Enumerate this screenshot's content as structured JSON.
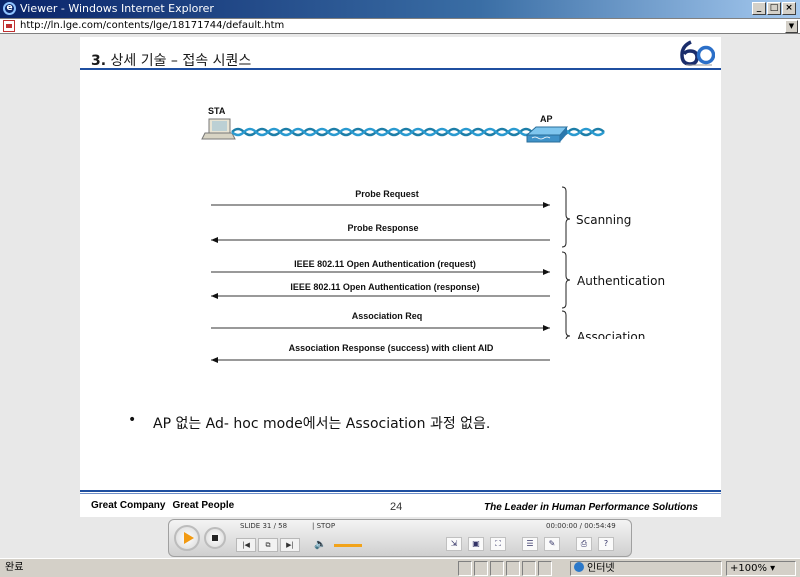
{
  "window": {
    "title": "Viewer - Windows Internet Explorer",
    "address": "http://ln.lge.com/contents/lge/18171744/default.htm",
    "buttons": {
      "minimize": "_",
      "maximize": "□",
      "close": "×"
    }
  },
  "slide": {
    "title_num": "3.",
    "title_text": "상세 기술 – 접속 시퀀스",
    "diagram": {
      "sta_label": "STA",
      "ap_label": "AP",
      "messages": [
        {
          "text": "Probe Request",
          "direction": "right"
        },
        {
          "text": "Probe Response",
          "direction": "left"
        },
        {
          "text": "IEEE 802.11 Open Authentication (request)",
          "direction": "right"
        },
        {
          "text": "IEEE 802.11 Open Authentication (response)",
          "direction": "left"
        },
        {
          "text": "Association Req",
          "direction": "right"
        },
        {
          "text": "Association Response (success) with client AID",
          "direction": "left"
        }
      ],
      "phases": [
        "Scanning",
        "Authentication",
        "Association"
      ]
    },
    "bullet": "AP 없는 Ad- hoc mode에서는 Association 과정 없음.",
    "footer": {
      "left_1": "Great Company",
      "left_2": "Great People",
      "page": "24",
      "right": "The Leader in Human Performance Solutions"
    }
  },
  "player": {
    "slide_info": "SLIDE 31 / 58",
    "state": "| STOP",
    "time": "00:00:00 / 00:54:49"
  },
  "status": {
    "left": "완료",
    "zone": "인터넷",
    "zoom": "100%"
  },
  "colors": {
    "accent": "#1f4fa0",
    "title_bar": "#0a246a",
    "player_play": "#f29a12"
  }
}
